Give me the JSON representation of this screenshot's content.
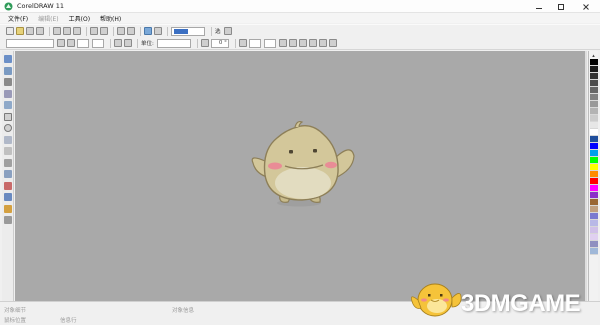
{
  "window": {
    "title": "CorelDRAW 11"
  },
  "menu": [
    {
      "label": "文件(F)",
      "enabled": true
    },
    {
      "label": "编辑(E)",
      "enabled": false
    },
    {
      "label": "工具(O)",
      "enabled": true
    },
    {
      "label": "帮助(H)",
      "enabled": true
    }
  ],
  "toolbar1": {
    "color_field_swatch": "#3b6fc2",
    "selection_mode": "选"
  },
  "toolbar2": {
    "unit_label": "单位:",
    "angle_value": "0 °"
  },
  "status": {
    "line1_left": "对象细节",
    "line2_left": "鼠标位置",
    "line2_mid": "信息行",
    "line1_right": "对象信息"
  },
  "watermark": {
    "text": "3DMGAME"
  },
  "palette_colors": [
    "#000000",
    "#1a1a1a",
    "#333333",
    "#4d4d4d",
    "#666666",
    "#808080",
    "#999999",
    "#b3b3b3",
    "#cccccc",
    "#e6e6e6",
    "#ffffff",
    "#1f4e9c",
    "#0000ff",
    "#00a0e9",
    "#00ff00",
    "#ffff00",
    "#ff8c00",
    "#ff0000",
    "#ff00ff",
    "#8b2fc9",
    "#996633",
    "#c0a080",
    "#7a7ad0",
    "#b8b8e6",
    "#d0c0e8",
    "#e0d0f0",
    "#9090c0",
    "#a0b8d8"
  ],
  "colors": {
    "canvas": "#a9a9a9",
    "mascot_body": "#d3c79a",
    "mascot_outline": "#8d7f58",
    "cheek": "#e98c96"
  }
}
